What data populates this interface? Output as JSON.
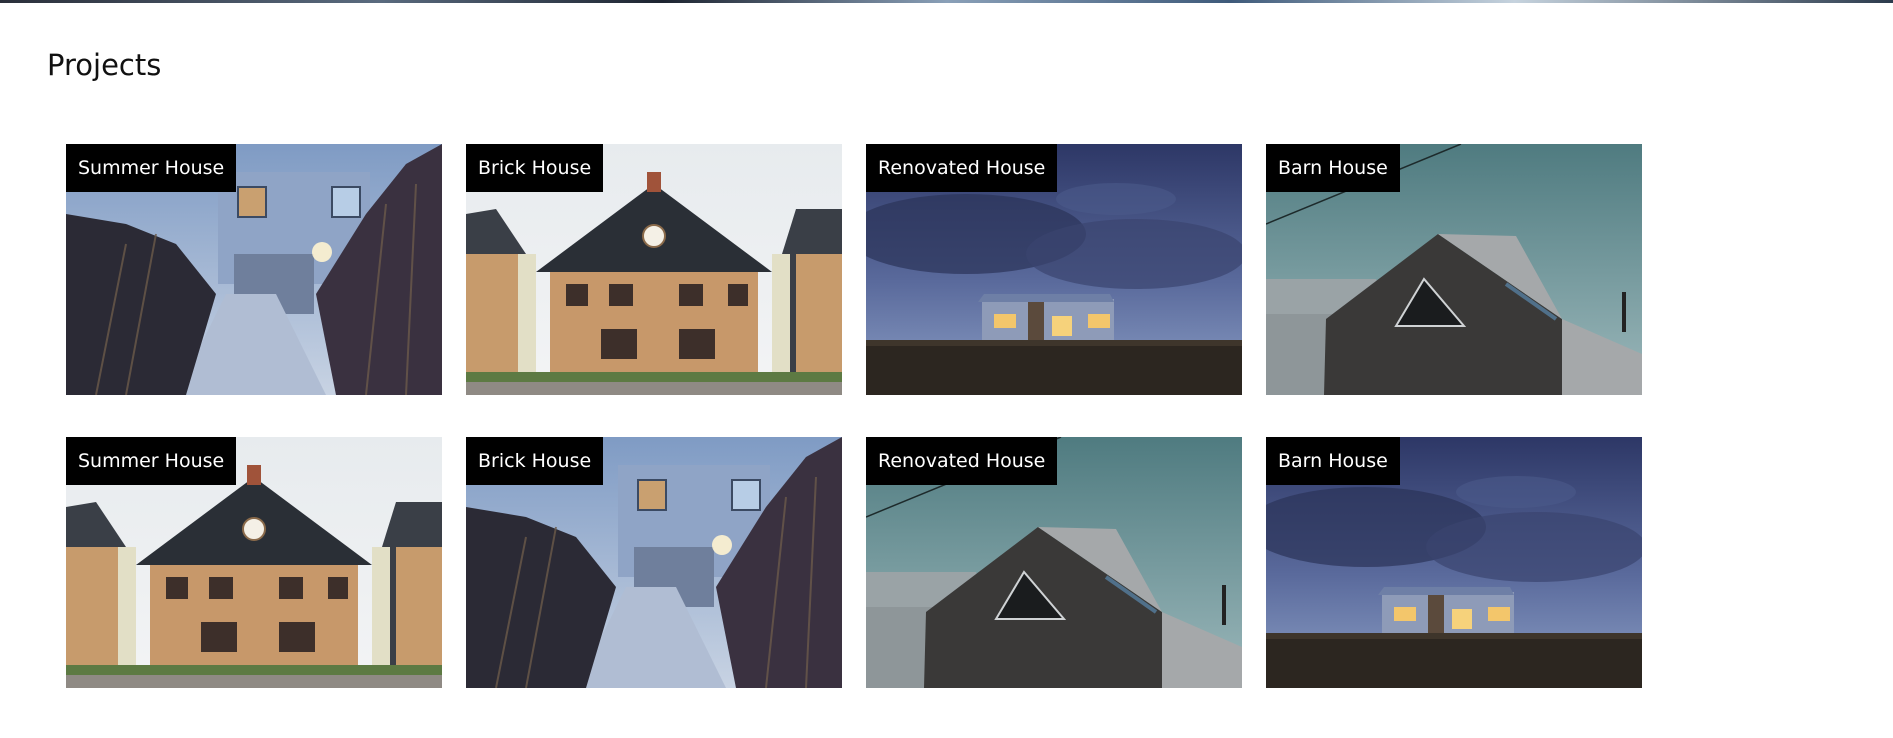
{
  "page": {
    "title": "Projects"
  },
  "projects": [
    {
      "label": "Summer House",
      "scene": "summer"
    },
    {
      "label": "Brick House",
      "scene": "brick"
    },
    {
      "label": "Renovated House",
      "scene": "renovated"
    },
    {
      "label": "Barn House",
      "scene": "barn"
    },
    {
      "label": "Summer House",
      "scene": "brick"
    },
    {
      "label": "Brick House",
      "scene": "summer"
    },
    {
      "label": "Renovated House",
      "scene": "barn"
    },
    {
      "label": "Barn House",
      "scene": "renovated"
    }
  ]
}
